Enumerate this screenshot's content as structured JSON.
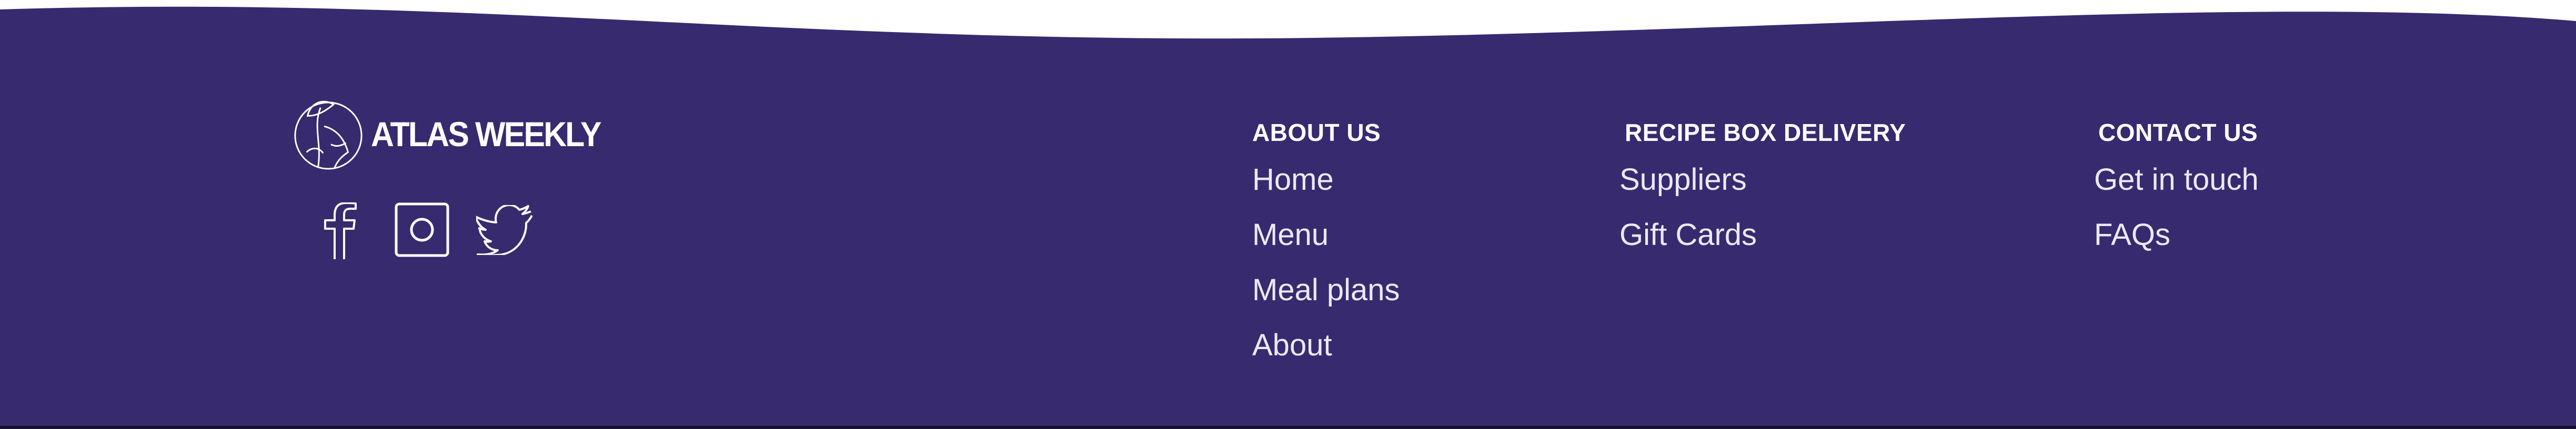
{
  "brand": {
    "name": "ATLAS WEEKLY",
    "logo_icon": "globe-leaf-logo"
  },
  "social": [
    {
      "network": "Facebook",
      "icon": "facebook-icon"
    },
    {
      "network": "Instagram",
      "icon": "instagram-icon"
    },
    {
      "network": "Twitter",
      "icon": "twitter-icon"
    }
  ],
  "columns": {
    "about": {
      "heading": "ABOUT US",
      "links": [
        "Home",
        "Menu",
        "Meal plans",
        "About"
      ]
    },
    "recipe_box": {
      "heading": "RECIPE BOX DELIVERY",
      "links": [
        "Suppliers",
        "Gift Cards"
      ]
    },
    "contact": {
      "heading": "CONTACT US",
      "links": [
        "Get in touch",
        "FAQs"
      ]
    }
  },
  "colors": {
    "footer_bg": "#382a6e",
    "page_bg": "#ffffff",
    "text": "#ffffff",
    "link_text": "#ece9f7"
  }
}
